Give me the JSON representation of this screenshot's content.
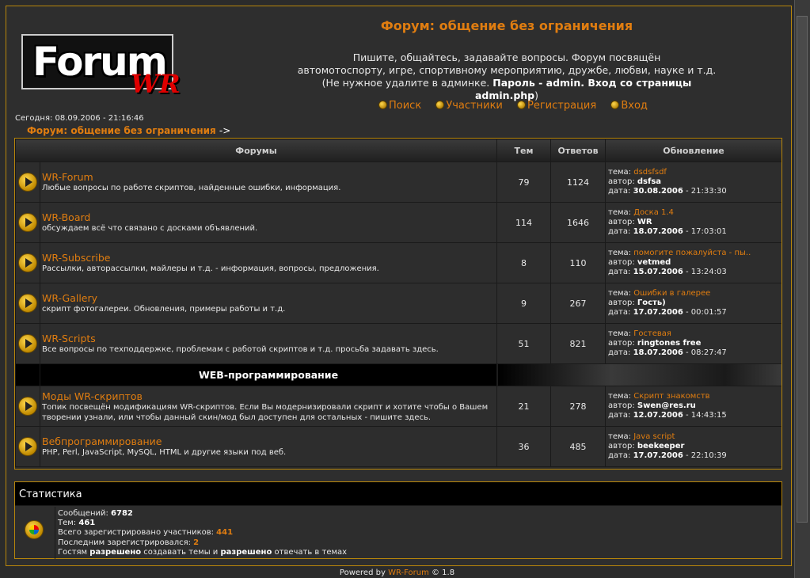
{
  "header": {
    "logo_text": "Forum",
    "logo_sub": "WR",
    "title": "Форум: общение без ограничения",
    "desc_line1": "Пишите, общайтесь, задавайте вопросы. Форум посвящён",
    "desc_line2": "автомотоспорту, игре, спортивному мероприятию, дружбе, любви, науке и т.д.",
    "desc_line3_prefix": "(Не нужное удалите в админке. ",
    "desc_line3_bold": "Пароль - admin. Вход со страницы admin.php",
    "desc_line3_suffix": ")"
  },
  "nav": {
    "search": "Поиск",
    "members": "Участники",
    "register": "Регистрация",
    "login": "Вход"
  },
  "today": "Сегодня: 08.09.2006 - 21:16:46",
  "breadcrumb": {
    "link": "Форум: общение без ограничения",
    "arrow": "->"
  },
  "table": {
    "headers": {
      "forums": "Форумы",
      "topics": "Тем",
      "replies": "Ответов",
      "updated": "Обновление"
    },
    "labels": {
      "topic": "тема: ",
      "author": "автор: ",
      "date": "дата: "
    },
    "group1": [
      {
        "name": "WR-Forum",
        "desc": "Любые вопросы по работе скриптов, найденные ошибки, информация.",
        "topics": "79",
        "replies": "1124",
        "last_topic": "dsdsfsdf",
        "author": "dsfsa",
        "date": "30.08.2006",
        "time": " - 21:33:30"
      },
      {
        "name": "WR-Board",
        "desc": "обсуждаем всё что связано с досками объявлений.",
        "topics": "114",
        "replies": "1646",
        "last_topic": "Доска 1.4",
        "author": "WR",
        "date": "18.07.2006",
        "time": " - 17:03:01"
      },
      {
        "name": "WR-Subscribe",
        "desc": "Рассылки, авторассылки, майлеры и т.д. - информация, вопросы, предложения.",
        "topics": "8",
        "replies": "110",
        "last_topic": "помогите пожалуйста - пы..",
        "author": "vetmed",
        "date": "15.07.2006",
        "time": " - 13:24:03"
      },
      {
        "name": "WR-Gallery",
        "desc": "скрипт фотогалереи. Обновления, примеры работы и т.д.",
        "topics": "9",
        "replies": "267",
        "last_topic": "Ошибки в галерее",
        "author": "Гость)",
        "date": "17.07.2006",
        "time": " - 00:01:57"
      },
      {
        "name": "WR-Scripts",
        "desc": "Все вопросы по техподдержке, проблемам с работой скриптов и т.д. просьба задавать здесь.",
        "topics": "51",
        "replies": "821",
        "last_topic": "Гостевая",
        "author": "ringtones free",
        "date": "18.07.2006",
        "time": " - 08:27:47"
      }
    ],
    "category": "WEB-программирование",
    "group2": [
      {
        "name": "Моды WR-скриптов",
        "desc": "Топик посвещён модификациям WR-скриптов. Если Вы модернизировали скрипт и хотите чтобы о Вашем творении узнали, или чтобы данный скин/мод был доступен для остальных - пишите здесь.",
        "topics": "21",
        "replies": "278",
        "last_topic": "Скрипт знакомств",
        "author": "Swen@res.ru",
        "date": "12.07.2006",
        "time": " - 14:43:15"
      },
      {
        "name": "Вебпрограммирование",
        "desc": "PHP, Perl, JavaScript, MySQL, HTML и другие языки под веб.",
        "topics": "36",
        "replies": "485",
        "last_topic": "Java script",
        "author": "beekeeper",
        "date": "17.07.2006",
        "time": " - 22:10:39"
      }
    ]
  },
  "stats": {
    "title": "Статистика",
    "posts_label": "Сообщений: ",
    "posts": "6782",
    "topics_label": "Тем: ",
    "topics": "461",
    "users_label": "Всего зарегистрировано участников: ",
    "users": "441",
    "last_label": "Последним зарегистрировался: ",
    "last": "2",
    "guests_1": "Гостям ",
    "guests_b1": "разрешено",
    "guests_2": " создавать темы и ",
    "guests_b2": "разрешено",
    "guests_3": " отвечать в темах"
  },
  "footer": {
    "prefix": "Powered by ",
    "brand": "WR-Forum",
    "suffix": " © 1.8"
  },
  "colors": {
    "accent": "#e07d10",
    "border": "#b8860b",
    "background": "#2b2b2b"
  }
}
